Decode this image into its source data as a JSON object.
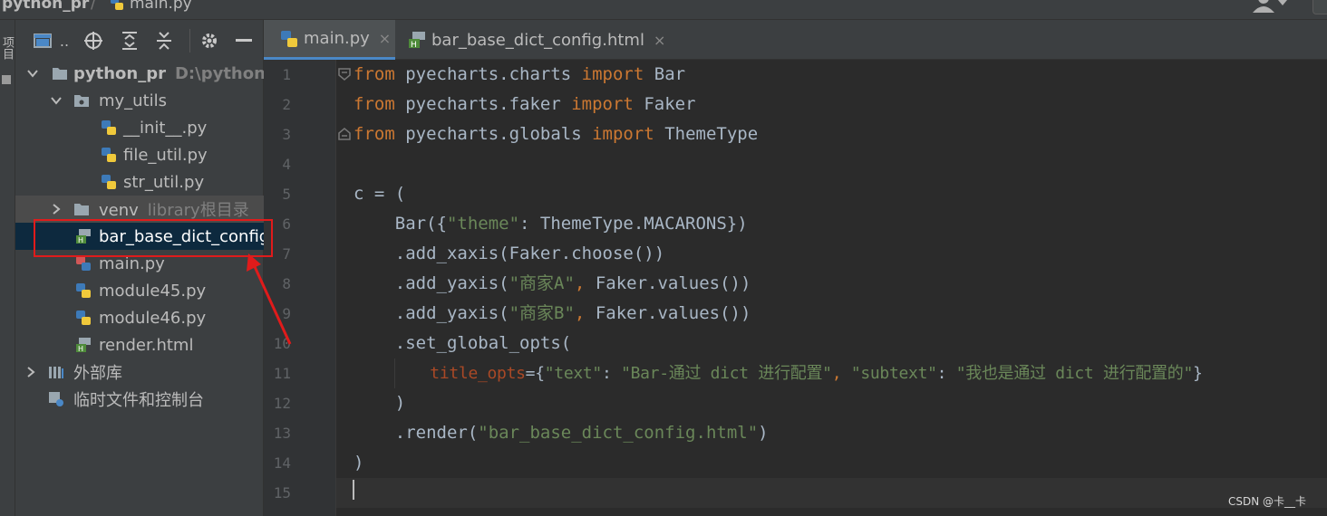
{
  "breadcrumb": {
    "project": "python_pr",
    "separator": "/",
    "file": "main.py"
  },
  "left_stripe": {
    "label": "项目"
  },
  "project_panel": {
    "toolbar": {
      "view_label": "..",
      "icons": [
        "locate-icon",
        "expand-all-icon",
        "collapse-all-icon",
        "settings-icon",
        "hide-icon"
      ]
    },
    "tree": [
      {
        "label": "python_pr",
        "sub": "D:\\python_p",
        "kind": "project-folder",
        "expanded": true
      },
      {
        "label": "my_utils",
        "kind": "package",
        "expanded": true
      },
      {
        "label": "__init__.py",
        "kind": "python-file"
      },
      {
        "label": "file_util.py",
        "kind": "python-file"
      },
      {
        "label": "str_util.py",
        "kind": "python-file"
      },
      {
        "label": "venv",
        "sub": "library根目录",
        "kind": "folder",
        "expanded": false
      },
      {
        "label": "bar_base_dict_config",
        "kind": "html-file",
        "selected": true
      },
      {
        "label": "main.py",
        "kind": "python-file"
      },
      {
        "label": "module45.py",
        "kind": "python-file"
      },
      {
        "label": "module46.py",
        "kind": "python-file"
      },
      {
        "label": "render.html",
        "kind": "html-file"
      },
      {
        "label": "外部库",
        "kind": "libraries",
        "expanded": false
      },
      {
        "label": "临时文件和控制台",
        "kind": "scratches"
      }
    ]
  },
  "tabs": [
    {
      "label": "main.py",
      "close": "×",
      "active": true
    },
    {
      "label": "bar_base_dict_config.html",
      "close": "×",
      "active": false
    }
  ],
  "editor": {
    "line_numbers": [
      "1",
      "2",
      "3",
      "4",
      "5",
      "6",
      "7",
      "8",
      "9",
      "10",
      "11",
      "12",
      "13",
      "14",
      "15"
    ],
    "lines": {
      "l1": {
        "kw1": "from",
        "mod": " pyecharts.charts ",
        "kw2": "import",
        "name": " Bar"
      },
      "l2": {
        "kw1": "from",
        "mod": " pyecharts.faker ",
        "kw2": "import",
        "name": " Faker"
      },
      "l3": {
        "kw1": "from",
        "mod": " pyecharts.globals ",
        "kw2": "import",
        "name": " ThemeType"
      },
      "l5": {
        "text": "c = ("
      },
      "l6": {
        "pre": "    Bar({",
        "key": "\"theme\"",
        "post": ": ThemeType.MACARONS})"
      },
      "l7": {
        "text": "    .add_xaxis(Faker.choose())"
      },
      "l8": {
        "pre": "    .add_yaxis(",
        "str": "\"商家A\"",
        "comma": ",",
        "post": " Faker.values())"
      },
      "l9": {
        "pre": "    .add_yaxis(",
        "str": "\"商家B\"",
        "comma": ",",
        "post": " Faker.values())"
      },
      "l10": {
        "text": "    .set_global_opts("
      },
      "l11": {
        "indent": "        ",
        "param": "title_opts",
        "eq": "={",
        "k1": "\"text\"",
        "c1": ": ",
        "v1": "\"Bar-通过 dict 进行配置\"",
        "sep": ",",
        "sp": " ",
        "k2": "\"subtext\"",
        "c2": ": ",
        "v2": "\"我也是通过 dict 进行配置的\"",
        "end": "}"
      },
      "l12": {
        "text": "    )"
      },
      "l13": {
        "pre": "    .render(",
        "str": "\"bar_base_dict_config.html\"",
        "post": ")"
      },
      "l14": {
        "text": ")"
      }
    }
  },
  "watermark": "CSDN @卡__卡",
  "colors": {
    "keyword": "#cc7832",
    "string": "#6a8759",
    "parameter": "#aa4926",
    "default": "#a9b7c6",
    "annotation": "#e01b1b",
    "selection": "#0d293e"
  }
}
